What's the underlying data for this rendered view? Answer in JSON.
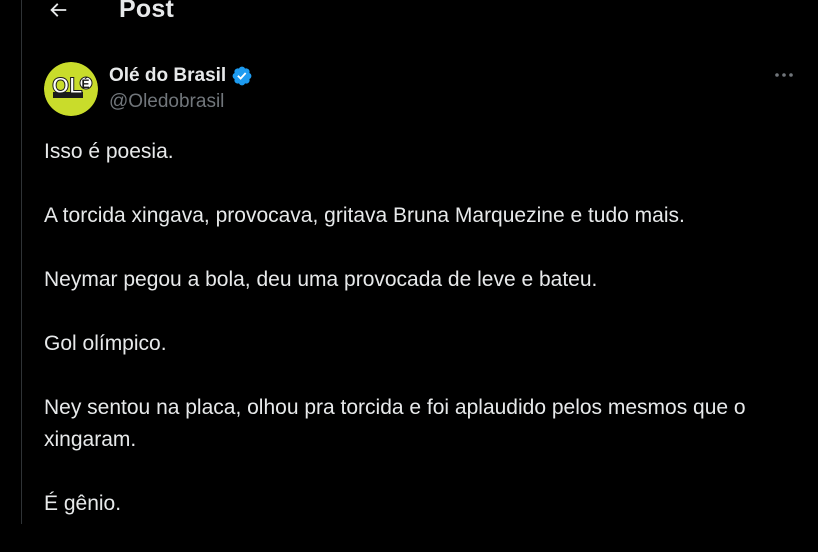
{
  "header": {
    "back_icon": "arrow-left-icon",
    "title": "Post"
  },
  "author": {
    "avatar_icon": "ole-logo-avatar",
    "name": "Olé do Brasil",
    "verified_icon": "verified-badge-icon",
    "handle": "@Oledobrasil"
  },
  "more_icon": "ellipsis-icon",
  "tweet": {
    "paragraphs": [
      "Isso é poesia.",
      "A torcida xingava, provocava, gritava Bruna Marquezine e tudo mais.",
      "Neymar pegou a bola, deu uma provocada de leve e bateu.",
      "Gol olímpico.",
      "Ney sentou na placa, olhou pra torcida e foi aplaudido pelos mesmos que o xingaram.",
      "É gênio."
    ]
  },
  "colors": {
    "background": "#000000",
    "text": "#e7e9ea",
    "secondary_text": "#71767b",
    "verified_blue": "#1d9bf0",
    "avatar_yellow": "#c9dc2b",
    "divider": "#2f3336"
  }
}
